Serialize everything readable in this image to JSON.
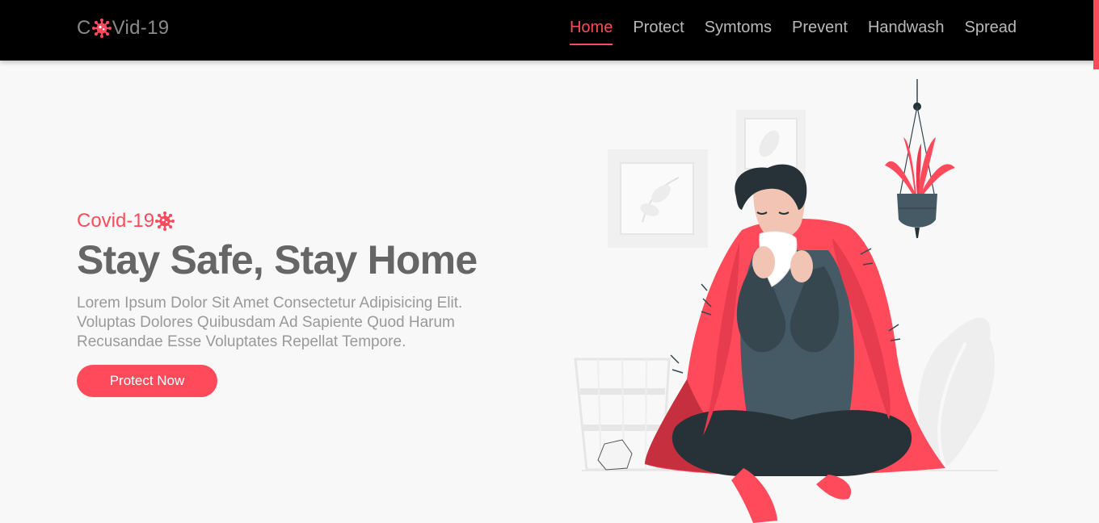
{
  "logo": {
    "prefix": "C",
    "suffix": "Vid-19",
    "icon": "virus-icon"
  },
  "nav": {
    "items": [
      {
        "label": "Home",
        "active": true
      },
      {
        "label": "Protect",
        "active": false
      },
      {
        "label": "Symtoms",
        "active": false
      },
      {
        "label": "Prevent",
        "active": false
      },
      {
        "label": "Handwash",
        "active": false
      },
      {
        "label": "Spread",
        "active": false
      }
    ]
  },
  "hero": {
    "eyebrow": "Covid-19",
    "title": "Stay Safe, Stay Home",
    "description": "Lorem Ipsum Dolor Sit Amet Consectetur Adipisicing Elit. Voluptas Dolores Quibusdam Ad Sapiente Quod Harum Recusandae Esse Voluptates Repellat Tempore.",
    "cta_label": "Protect Now"
  },
  "illustration": {
    "icon": "sick-man-sneezing-illustration"
  },
  "colors": {
    "accent": "#ff4a5c",
    "nav_bg": "#000000",
    "page_bg": "#f8f8f8",
    "heading": "#666666",
    "body_text": "#999999"
  }
}
